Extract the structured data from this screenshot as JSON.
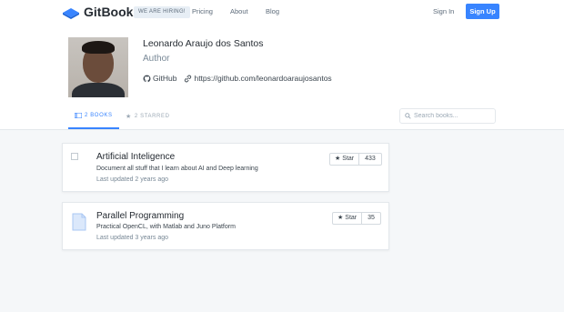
{
  "header": {
    "logo_text": "GitBook",
    "hiring_badge": "WE ARE HIRING!",
    "nav": [
      "Pricing",
      "About",
      "Blog"
    ],
    "signin": "Sign In",
    "signup": "Sign Up"
  },
  "profile": {
    "name": "Leonardo Araujo dos Santos",
    "role": "Author",
    "github_label": "GitHub",
    "website": "https://github.com/leonardoaraujosantos"
  },
  "tabs": {
    "books": "2 BOOKS",
    "starred": "2 STARRED"
  },
  "search": {
    "placeholder": "Search books..."
  },
  "books": [
    {
      "title": "Artificial Inteligence",
      "description": "Document all stuff that I learn about AI and Deep learning",
      "updated": "Last updated 2 years ago",
      "star_label": "Star",
      "stars": "433"
    },
    {
      "title": "Parallel Programming",
      "description": "Practical OpenCL, with Matlab and Juno Platform",
      "updated": "Last updated 3 years ago",
      "star_label": "Star",
      "stars": "35"
    }
  ],
  "colors": {
    "accent": "#3884ff"
  }
}
